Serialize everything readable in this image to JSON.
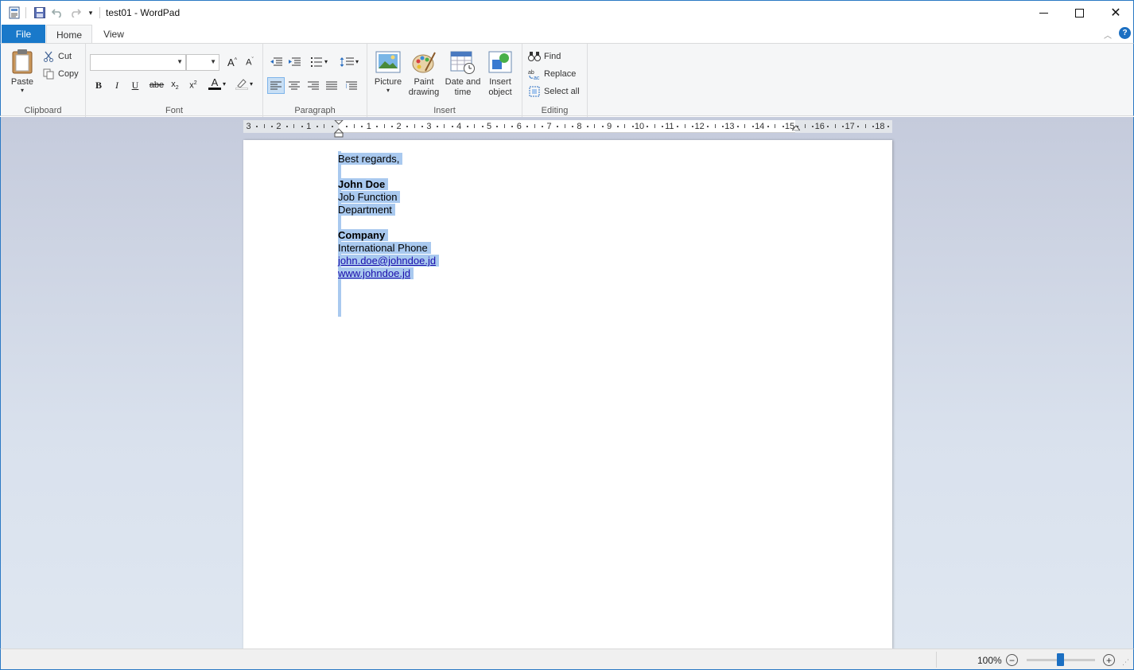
{
  "window": {
    "title": "test01 - WordPad",
    "controls": {
      "minimize": "—",
      "maximize": "☐",
      "close": "✕"
    }
  },
  "quick_access": [
    "save-icon",
    "undo-icon",
    "redo-icon",
    "customize-qat-icon"
  ],
  "tabs": {
    "file": "File",
    "home": "Home",
    "view": "View"
  },
  "ribbon": {
    "clipboard": {
      "label": "Clipboard",
      "paste": "Paste",
      "cut": "Cut",
      "copy": "Copy"
    },
    "font": {
      "label": "Font",
      "family_value": "",
      "size_value": ""
    },
    "paragraph": {
      "label": "Paragraph"
    },
    "insert": {
      "label": "Insert",
      "picture": "Picture",
      "paint_drawing_1": "Paint",
      "paint_drawing_2": "drawing",
      "date_time_1": "Date and",
      "date_time_2": "time",
      "insert_object_1": "Insert",
      "insert_object_2": "object"
    },
    "editing": {
      "label": "Editing",
      "find": "Find",
      "replace": "Replace",
      "select_all": "Select all"
    }
  },
  "ruler": {
    "left_numbers": [
      "3",
      "2",
      "1"
    ],
    "right_numbers": [
      "1",
      "2",
      "3",
      "4",
      "5",
      "6",
      "7",
      "8",
      "9",
      "10",
      "11",
      "12",
      "13",
      "14",
      "15",
      "16",
      "17",
      "18"
    ]
  },
  "document": {
    "lines": [
      {
        "text": "Best regards,",
        "style": "normal"
      },
      {
        "text": "",
        "style": "normal"
      },
      {
        "text": "John Doe",
        "style": "bold"
      },
      {
        "text": "Job Function",
        "style": "normal"
      },
      {
        "text": "Department",
        "style": "normal"
      },
      {
        "text": "",
        "style": "normal"
      },
      {
        "text": "Company",
        "style": "bold"
      },
      {
        "text": "International Phone",
        "style": "normal"
      },
      {
        "text": "john.doe@johndoe.jd",
        "style": "link"
      },
      {
        "text": "www.johndoe.jd",
        "style": "link"
      }
    ]
  },
  "status": {
    "zoom": "100%"
  },
  "colors": {
    "accent": "#1979ca",
    "selection": "#a9c9ef",
    "link": "#1a0dab"
  }
}
